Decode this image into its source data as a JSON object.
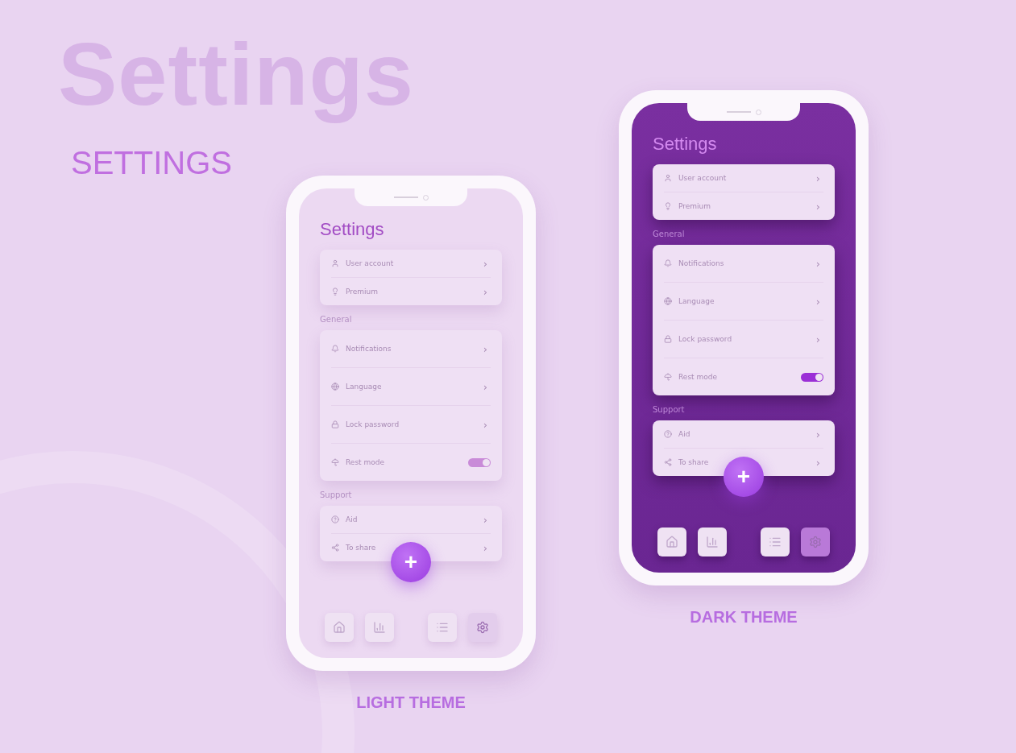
{
  "backdrop_title": "Settings",
  "heading": "SETTINGS",
  "phones": [
    {
      "kind": "light",
      "caption": "LIGHT THEME",
      "title": "Settings",
      "groups": [
        {
          "items": [
            {
              "label": "User account",
              "kind": "link",
              "chevron": "›"
            },
            {
              "label": "Premium",
              "kind": "link",
              "chevron": "›"
            }
          ]
        },
        {
          "label": "General",
          "items": [
            {
              "label": "Notifications",
              "kind": "link",
              "chevron": "›"
            },
            {
              "label": "Language",
              "kind": "link",
              "chevron": "›"
            },
            {
              "label": "Lock password",
              "kind": "link",
              "chevron": "›"
            },
            {
              "label": "Rest mode",
              "kind": "toggle",
              "on": true
            }
          ]
        },
        {
          "label": "Support",
          "items": [
            {
              "label": "Aid",
              "kind": "link",
              "chevron": "›"
            },
            {
              "label": "To share",
              "kind": "link",
              "chevron": "›"
            }
          ]
        }
      ],
      "fab": "+",
      "nav": [
        {
          "selected": false
        },
        {
          "selected": false
        },
        {
          "selected": false
        },
        {
          "selected": true
        }
      ]
    },
    {
      "kind": "dark",
      "caption": "DARK THEME",
      "title": "Settings",
      "groups": [
        {
          "items": [
            {
              "label": "User account",
              "kind": "link",
              "chevron": "›"
            },
            {
              "label": "Premium",
              "kind": "link",
              "chevron": "›"
            }
          ]
        },
        {
          "label": "General",
          "items": [
            {
              "label": "Notifications",
              "kind": "link",
              "chevron": "›"
            },
            {
              "label": "Language",
              "kind": "link",
              "chevron": "›"
            },
            {
              "label": "Lock password",
              "kind": "link",
              "chevron": "›"
            },
            {
              "label": "Rest mode",
              "kind": "toggle",
              "on": true
            }
          ]
        },
        {
          "label": "Support",
          "items": [
            {
              "label": "Aid",
              "kind": "link",
              "chevron": "›"
            },
            {
              "label": "To share",
              "kind": "link",
              "chevron": "›"
            }
          ]
        }
      ],
      "fab": "+",
      "nav": [
        {
          "selected": false
        },
        {
          "selected": false
        },
        {
          "selected": false
        },
        {
          "selected": true
        }
      ]
    }
  ]
}
